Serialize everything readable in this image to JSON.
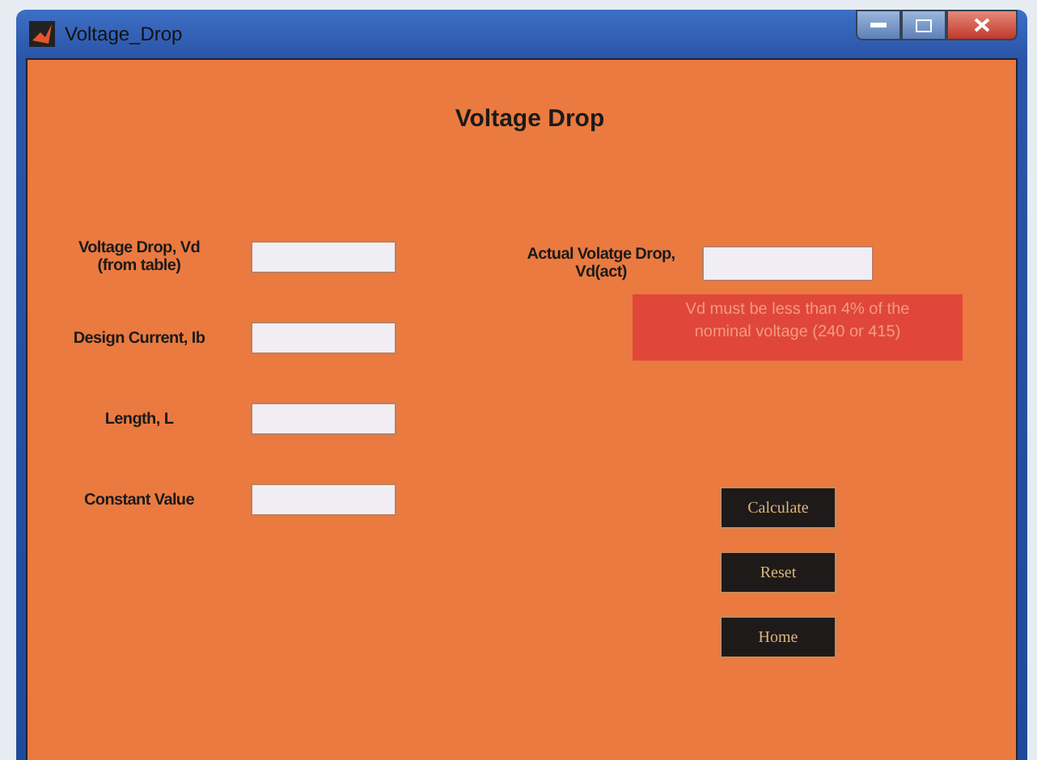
{
  "window": {
    "title": "Voltage_Drop"
  },
  "heading": "Voltage Drop",
  "inputs": [
    {
      "label": "Voltage Drop, Vd\n(from table)"
    },
    {
      "label": "Design Current, Ib"
    },
    {
      "label": "Length, L"
    },
    {
      "label": "Constant Value"
    }
  ],
  "result": {
    "label": "Actual Volatge Drop,\nVd(act)"
  },
  "warning": "Vd must be less than 4% of the nominal voltage (240 or 415)",
  "buttons": [
    "Calculate",
    "Reset",
    "Home"
  ]
}
